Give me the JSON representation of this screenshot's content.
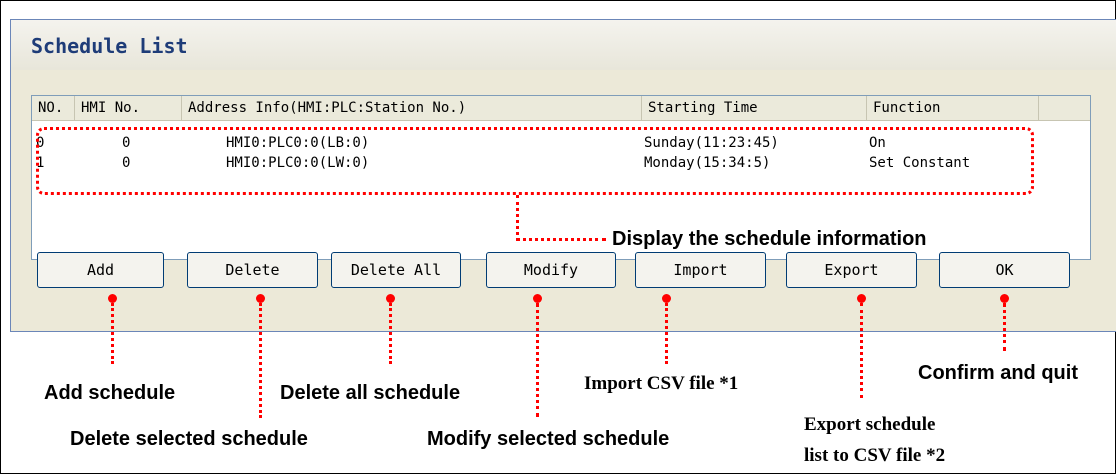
{
  "dialog": {
    "title": "Schedule List",
    "columns": [
      "NO.",
      "HMI No.",
      "Address Info(HMI:PLC:Station No.)",
      "Starting Time",
      "Function"
    ],
    "rows": [
      {
        "no": "0",
        "hmi": "0",
        "address": "HMI0:PLC0:0(LB:0)",
        "time": "Sunday(11:23:45)",
        "function": "On"
      },
      {
        "no": "1",
        "hmi": "0",
        "address": "HMI0:PLC0:0(LW:0)",
        "time": "Monday(15:34:5)",
        "function": "Set Constant"
      }
    ],
    "buttons": {
      "add": "Add",
      "delete": "Delete",
      "delete_all": "Delete All",
      "modify": "Modify",
      "import": "Import",
      "export": "Export",
      "ok": "OK"
    }
  },
  "annotations": {
    "display": "Display the schedule information",
    "add": "Add schedule",
    "delete": "Delete selected schedule",
    "delete_all": "Delete all schedule",
    "modify": "Modify selected schedule",
    "import": "Import CSV file *1",
    "export_line1": "Export schedule",
    "export_line2": "list to CSV file *2",
    "ok": "Confirm and quit"
  },
  "colors": {
    "annotation": "#ff0000",
    "title": "#1e3c78",
    "dialog_bg": "#ece9d8"
  }
}
